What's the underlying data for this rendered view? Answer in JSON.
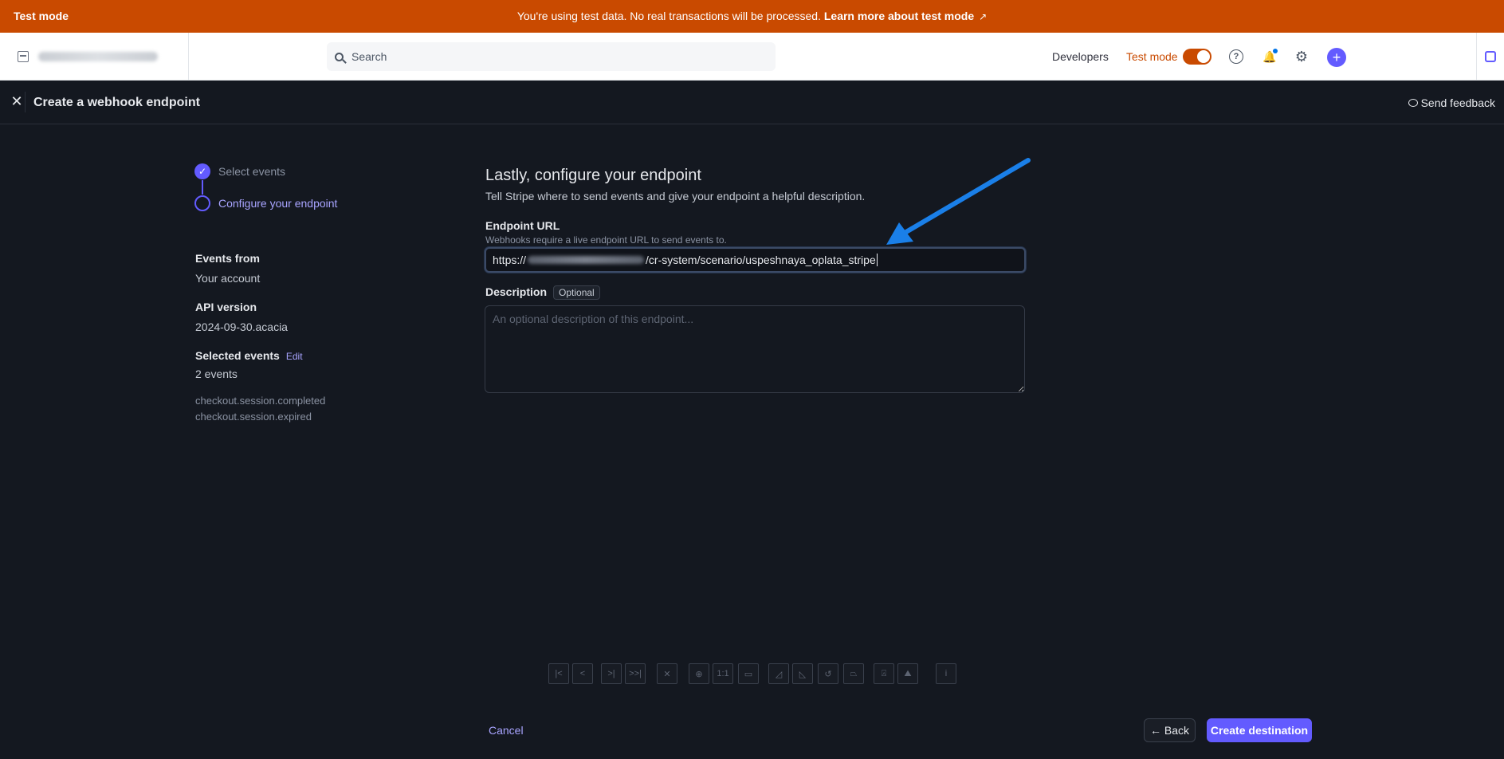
{
  "banner": {
    "mode_label": "Test mode",
    "message": "You're using test data. No real transactions will be processed. ",
    "link": "Learn more about test mode",
    "ext_icon": "external-link-icon"
  },
  "header": {
    "search_placeholder": "Search",
    "developers": "Developers",
    "test_mode": "Test mode",
    "help_glyph": "?",
    "bell_glyph": "🔔",
    "gear_glyph": "⚙",
    "plus_glyph": "+"
  },
  "modal": {
    "close_glyph": "✕",
    "title": "Create a webhook endpoint",
    "feedback": "Send feedback"
  },
  "steps": [
    {
      "label": "Select events",
      "check": "✓"
    },
    {
      "label": "Configure your endpoint"
    }
  ],
  "meta": {
    "events_from_h": "Events from",
    "events_from_v": "Your account",
    "api_h": "API version",
    "api_v": "2024-09-30.acacia",
    "selected_h": "Selected events",
    "edit": "Edit",
    "selected_v": "2 events",
    "event1": "checkout.session.completed",
    "event2": "checkout.session.expired"
  },
  "form": {
    "heading": "Lastly, configure your endpoint",
    "sub": "Tell Stripe where to send events and give your endpoint a helpful description.",
    "url_label": "Endpoint URL",
    "url_hint": "Webhooks require a live endpoint URL to send events to.",
    "url_prefix": "https://",
    "url_suffix": "/cr-system/scenario/uspeshnaya_oplata_stripe",
    "desc_label": "Description",
    "optional": "Optional",
    "desc_placeholder": "An optional description of this endpoint..."
  },
  "viewer_tools": [
    "|<",
    "<",
    ">|",
    ">>|",
    "✕",
    "⊕",
    "1:1",
    "▭",
    "◿",
    "◺",
    "↺",
    "⏢",
    "⍓",
    "⛰",
    "i"
  ],
  "footer": {
    "cancel": "Cancel",
    "back": "← Back",
    "create": "Create destination"
  },
  "colors": {
    "banner": "#c94a00",
    "accent": "#635bff",
    "arrow": "#1a7fe8"
  }
}
